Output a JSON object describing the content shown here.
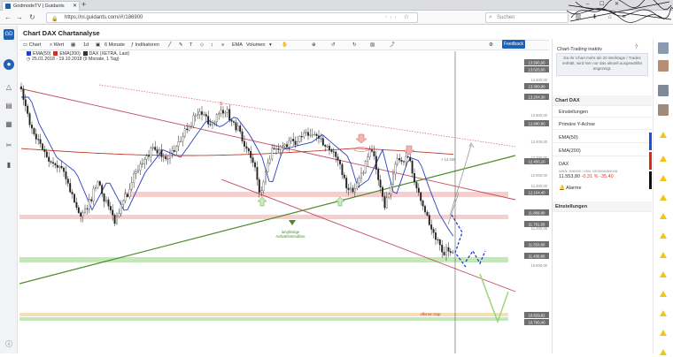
{
  "browser": {
    "tab_title": "GodmodeTV | Guidants",
    "new_tab": "+",
    "url": "https://ni.guidants.com/#!/186900",
    "search_placeholder": "Suchen",
    "window_controls": "– ☐ ✕"
  },
  "app": {
    "title": "Chart DAX Chartanalyse",
    "toolbar": {
      "chart_label": "Chart",
      "wert_label": "Wert",
      "interval_label": "1d",
      "range_label": "6 Monate",
      "indicators_label": "Indikatoren",
      "ema_label": "EMA",
      "volume_label": "Volumen",
      "feedback_label": "Feedback"
    },
    "legend": {
      "ema50": "EMA(50)",
      "ema200": "EMA(200)",
      "instrument": "DAX (XETRA, Last)",
      "period": "25.01.2018 - 19.10.2018 (9 Monate, 1 Tag)"
    }
  },
  "chart_data": {
    "type": "candlestick",
    "y_ticks": [
      "13.400,00",
      "13.000,00",
      "12.800,00",
      "12.600,00",
      "12.400,00",
      "12.200,00",
      "12.000,00",
      "11.400,00",
      "11.200,00",
      "11.000,00",
      "10.800,00"
    ],
    "price_labels": [
      {
        "text": "13.596,90",
        "kind": "gray"
      },
      {
        "text": "13.525,60",
        "kind": "gray"
      },
      {
        "text": "13.309,80",
        "kind": "gray"
      },
      {
        "text": "13.204,30",
        "kind": "gray"
      },
      {
        "text": "12.880,60",
        "kind": "gray"
      },
      {
        "text": "12.456,10",
        "kind": "gray"
      },
      {
        "text": "12.104,40",
        "kind": "gray"
      },
      {
        "text": "11.869,80",
        "kind": "gray"
      },
      {
        "text": "11.781,58",
        "kind": "gray"
      },
      {
        "text": "11.553,80",
        "kind": "gray"
      },
      {
        "text": "11.430,80",
        "kind": "gray"
      },
      {
        "text": "10.829,82",
        "kind": "gray"
      },
      {
        "text": "10.780,40",
        "kind": "gray"
      }
    ],
    "annotations": {
      "trend_label": "langfristige Aufwärtstrendlinie",
      "gap_label": "offenen Gap",
      "target_label": "> 12.459",
      "marker_s": "S"
    },
    "series": [
      {
        "name": "EMA(50)",
        "color": "#2b3fbf"
      },
      {
        "name": "EMA(200)",
        "color": "#c0392b"
      }
    ]
  },
  "panel": {
    "title": "Chart-Trading inaktiv",
    "help": "?",
    "info": "Da Ihr Chart mehr als 20 Werktage / Trades enthält, wird hier nur das aktuell ausgewählte angezeigt.",
    "section_chart": "Chart DAX",
    "rows": [
      "Einstellungen",
      "Primäre Y-Achse",
      "EMA(50)",
      "EMA(200)"
    ],
    "dax": {
      "name": "DAX",
      "wkn": "WKN: 846900 / ISIN: DE0008469008",
      "price": "11.553,80",
      "change": "-0,31 %   -35,40"
    },
    "alarm": "Alarme",
    "section_settings": "Einstellungen"
  },
  "colors": {
    "accent": "#1f62b5",
    "resistance_band": "#f6c9c9",
    "support_band": "#bfe6b4",
    "gap_band": "#f3dcae",
    "trendline": "#4a8a2c",
    "channel": "#c04b5c",
    "forecast_blue": "#1f3fd0",
    "forecast_green": "#9ad67c",
    "badge_yellow": "#f2c513"
  }
}
